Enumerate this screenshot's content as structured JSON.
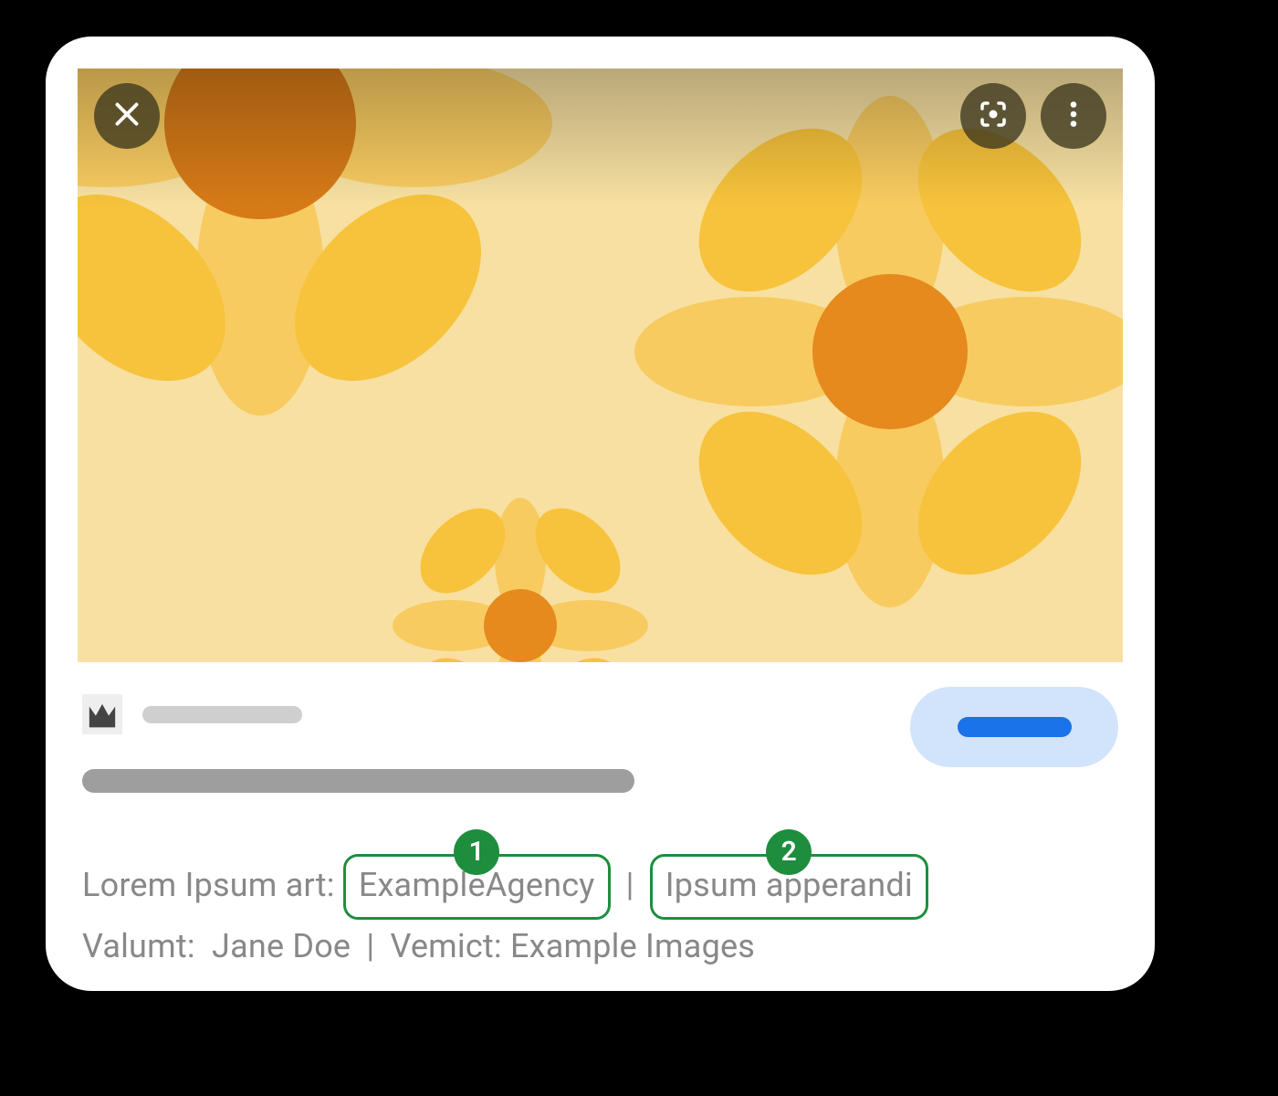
{
  "credits": {
    "label1": "Lorem Ipsum art:",
    "callout1_text": "ExampleAgency",
    "callout1_badge": "1",
    "callout2_text": "Ipsum apperandi",
    "callout2_badge": "2",
    "separator": "|",
    "label2a": "Valumt:",
    "value2a": "Jane Doe",
    "label2b": "Vemict:",
    "value2b": "Example Images"
  }
}
